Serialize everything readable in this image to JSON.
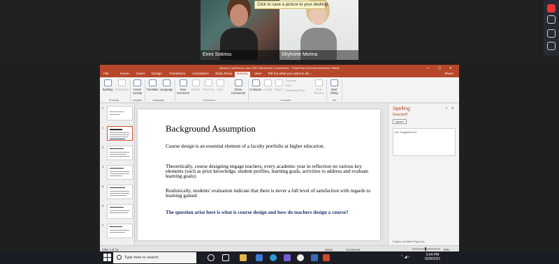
{
  "meeting": {
    "tooltip": "Click to save a picture to your desktop.",
    "participants": [
      {
        "name": "Eirini Sotiriou"
      },
      {
        "name": "Shyhrete Morina"
      }
    ]
  },
  "ppt": {
    "window_title": "Brasovi Conference June 2021 WorldCare 5 conference - PowerPoint (Product Activation Failed)",
    "tabs": [
      "File",
      "Home",
      "Insert",
      "Design",
      "Transitions",
      "Animations",
      "Slide Show",
      "Review",
      "View"
    ],
    "active_tab": "Review",
    "tell_me": "Tell me what you want to do...",
    "share": "Share",
    "ribbon": {
      "spelling": "Spelling",
      "thesaurus": "Thesaurus",
      "smart_lookup": "Smart Lookup",
      "translate": "Translate",
      "language": "Language",
      "new_comment": "New Comment",
      "delete": "Delete",
      "previous": "Previous",
      "next": "Next",
      "show_comments": "Show Comments",
      "compare": "Compare",
      "accept": "Accept",
      "reject": "Reject",
      "prev_small": "Previous",
      "next_small": "Next",
      "reviewing_pane": "Reviewing Pane",
      "end_review": "End Review",
      "start_inking": "Start Inking",
      "groups": {
        "proofing": "Proofing",
        "insights": "Insights",
        "language": "Language",
        "comments": "Comments",
        "compare": "Compare",
        "ink": "Ink"
      }
    },
    "thumb_numbers": [
      "1",
      "2",
      "3",
      "4",
      "5",
      "6",
      "7"
    ],
    "slide": {
      "title": "Background Assumption",
      "p1": "Course design is an essential element of a faculty portfolio at higher education.",
      "p2": "Theoretically, course designing engage teachers, every academic year in reflection on various key elements (such as prior knowledge, student profiles, learning goals, activities to address and evaluate learning goals).",
      "p3": "Realistically,  students' evaluation indicate that there is never a full level of satisfaction with regards to learning gained.",
      "p4": "The question arise here is what is course design and how do teachers design a course?"
    },
    "spelling_pane": {
      "title": "Spelling",
      "word": "Deardorff",
      "ignore": "Ignore",
      "suggestions": "(No Suggestions)",
      "language": "English (United Kingdom)"
    },
    "status": {
      "slide_of": "Slide 2 of 15",
      "notes": "Notes",
      "comments": "Comments",
      "zoom": "69%"
    },
    "watermark_line1": "Activate Windows",
    "watermark_line2": "Go to Settings to activate Windows."
  },
  "taskbar": {
    "search_placeholder": "Type here to search",
    "time": "5:04 PM",
    "date": "6/28/2021",
    "lang": "ENG"
  },
  "colors": {
    "ppt_accent": "#b7472a",
    "slide_blue_text": "#1f2f6b"
  }
}
